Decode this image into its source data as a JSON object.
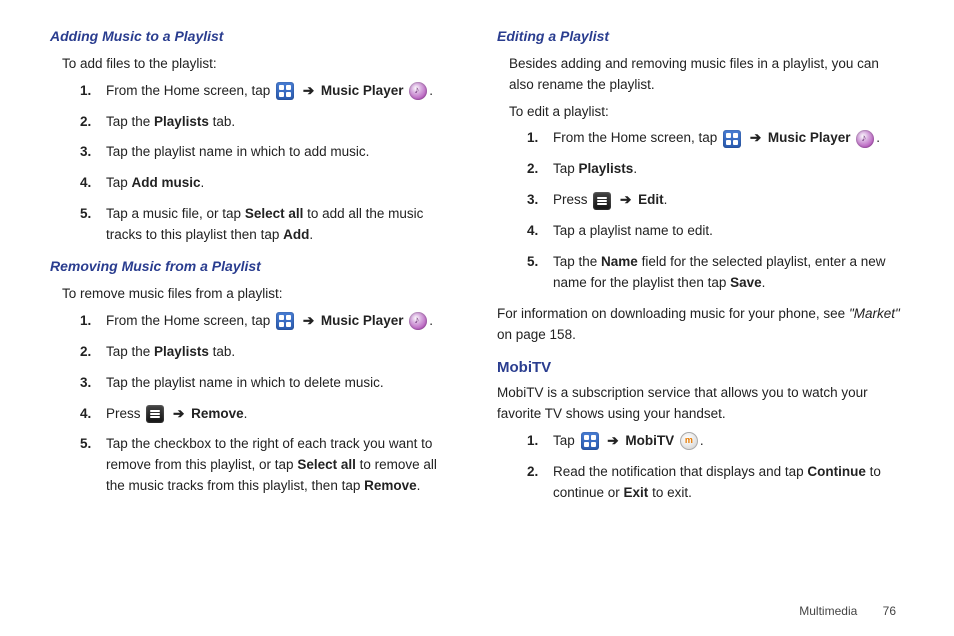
{
  "left": {
    "h1": "Adding Music to a Playlist",
    "intro1": "To add files to the playlist:",
    "steps1": {
      "s1a": "From the Home screen, tap ",
      "s1b": "Music Player",
      "s2a": "Tap the ",
      "s2b": "Playlists",
      "s2c": " tab.",
      "s3": "Tap the playlist name in which to add music.",
      "s4a": "Tap ",
      "s4b": "Add music",
      "s5a": "Tap a music file, or tap ",
      "s5b": "Select all",
      "s5c": " to add all the music tracks to this playlist then tap ",
      "s5d": "Add"
    },
    "h2": "Removing Music from a Playlist",
    "intro2": "To remove music files from a playlist:",
    "steps2": {
      "s1a": "From the Home screen, tap ",
      "s1b": "Music Player",
      "s2a": "Tap the ",
      "s2b": "Playlists",
      "s2c": " tab.",
      "s3": "Tap the playlist name in which to delete music.",
      "s4a": "Press ",
      "s4b": "Remove",
      "s5a": "Tap the checkbox to the right of each track you want to remove from this playlist, or tap ",
      "s5b": "Select all",
      "s5c": " to remove all the music tracks from this playlist, then tap ",
      "s5d": "Remove"
    }
  },
  "right": {
    "h1": "Editing a Playlist",
    "intro1": "Besides adding and removing music files in a playlist, you can also rename the playlist.",
    "intro2": "To edit a playlist:",
    "steps1": {
      "s1a": "From the Home screen, tap ",
      "s1b": "Music Player",
      "s2a": "Tap ",
      "s2b": "Playlists",
      "s3a": "Press ",
      "s3b": "Edit",
      "s4": "Tap a playlist name to edit.",
      "s5a": "Tap the ",
      "s5b": "Name",
      "s5c": " field for the selected playlist, enter a new name for the playlist then tap ",
      "s5d": "Save"
    },
    "note1a": "For information on downloading music for your phone, see ",
    "note1b": "\"Market\"",
    "note1c": " on page 158.",
    "h2": "MobiTV",
    "intro3": "MobiTV is a subscription service that allows you to watch your favorite TV shows using your handset.",
    "steps2": {
      "s1a": "Tap ",
      "s1b": "MobiTV",
      "s2a": "Read the notification that displays and tap ",
      "s2b": "Continue",
      "s2c": " to continue or ",
      "s2d": "Exit",
      "s2e": " to exit."
    }
  },
  "arrow": "➔",
  "footer": {
    "section": "Multimedia",
    "page": "76"
  }
}
